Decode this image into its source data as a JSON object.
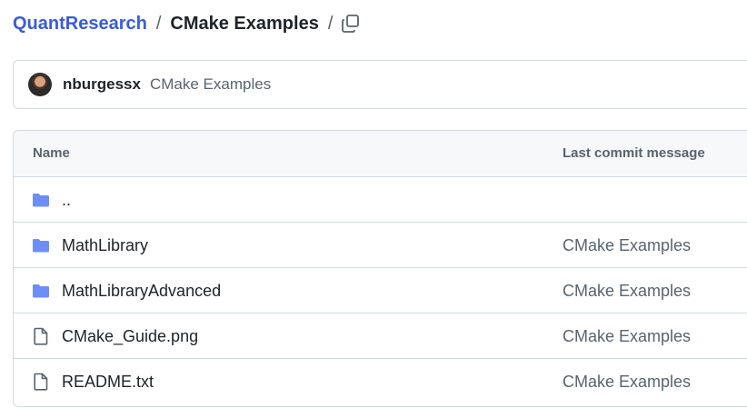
{
  "breadcrumb": {
    "repo": "QuantResearch",
    "separator": "/",
    "current": "CMake Examples",
    "trailing_separator": "/"
  },
  "commit": {
    "author": "nburgessx",
    "message": "CMake Examples"
  },
  "table": {
    "columns": {
      "name": "Name",
      "last_commit": "Last commit message"
    },
    "rows": [
      {
        "type": "parent",
        "icon": "folder-icon",
        "name": "..",
        "message": ""
      },
      {
        "type": "folder",
        "icon": "folder-icon",
        "name": "MathLibrary",
        "message": "CMake Examples"
      },
      {
        "type": "folder",
        "icon": "folder-icon",
        "name": "MathLibraryAdvanced",
        "message": "CMake Examples"
      },
      {
        "type": "file",
        "icon": "file-icon",
        "name": "CMake_Guide.png",
        "message": "CMake Examples"
      },
      {
        "type": "file",
        "icon": "file-icon",
        "name": "README.txt",
        "message": "CMake Examples"
      }
    ]
  },
  "colors": {
    "link": "#3a5bd9",
    "folder": "#6d8ff5",
    "border": "#d1d9e0",
    "header_bg": "#f6f8fa"
  }
}
